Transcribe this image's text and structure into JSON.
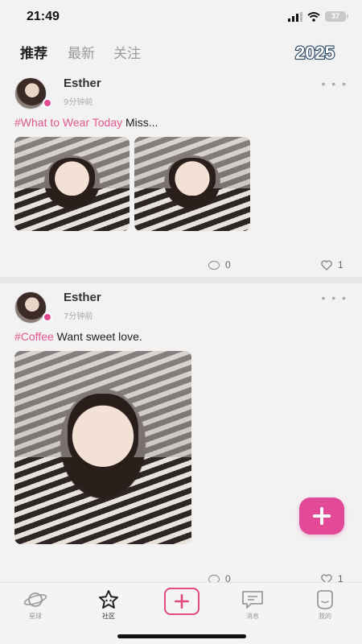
{
  "status_bar": {
    "time": "21:49",
    "battery": "37"
  },
  "top_tabs": {
    "tabs": [
      "推荐",
      "最新",
      "关注"
    ],
    "active_index": 0,
    "badge": "2025"
  },
  "posts": [
    {
      "author": "Esther",
      "time": "9分钟前",
      "hashtag": "#What to Wear Today",
      "text": " Miss...",
      "comments": "0",
      "likes": "1",
      "image_count": 2
    },
    {
      "author": "Esther",
      "time": "7分钟前",
      "hashtag": "#Coffee",
      "text": " Want sweet love.",
      "comments": "0",
      "likes": "1",
      "image_count": 1
    }
  ],
  "bottom_nav": {
    "items": [
      {
        "label": "星球",
        "icon": "planet-icon"
      },
      {
        "label": "社区",
        "icon": "star-icon"
      },
      {
        "label": "",
        "icon": "plus-box-icon"
      },
      {
        "label": "消息",
        "icon": "message-icon"
      },
      {
        "label": "我的",
        "icon": "profile-face-icon"
      }
    ],
    "active_index": 1
  },
  "colors": {
    "accent": "#e24a98",
    "hashtag": "#e0578f",
    "post_button": "#e24a7a",
    "badge_stroke": "#1d3d5c"
  }
}
